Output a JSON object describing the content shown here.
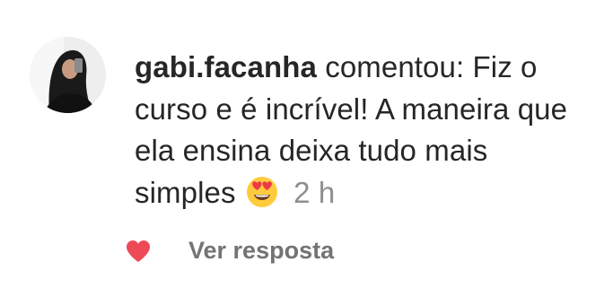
{
  "comment": {
    "username": "gabi.facanha",
    "action": "comentou:",
    "text": "Fiz o curso e é incrível! A maneira que ela ensina deixa tudo mais simples",
    "emoji": "smiling-face-with-heart-eyes",
    "timestamp": "2 h",
    "liked": true
  },
  "actions": {
    "reply_label": "Ver resposta"
  },
  "icons": {
    "heart": "heart-icon",
    "avatar": "profile-avatar"
  },
  "colors": {
    "text": "#262626",
    "muted": "#8e8e8e",
    "heart": "#ed4956"
  }
}
